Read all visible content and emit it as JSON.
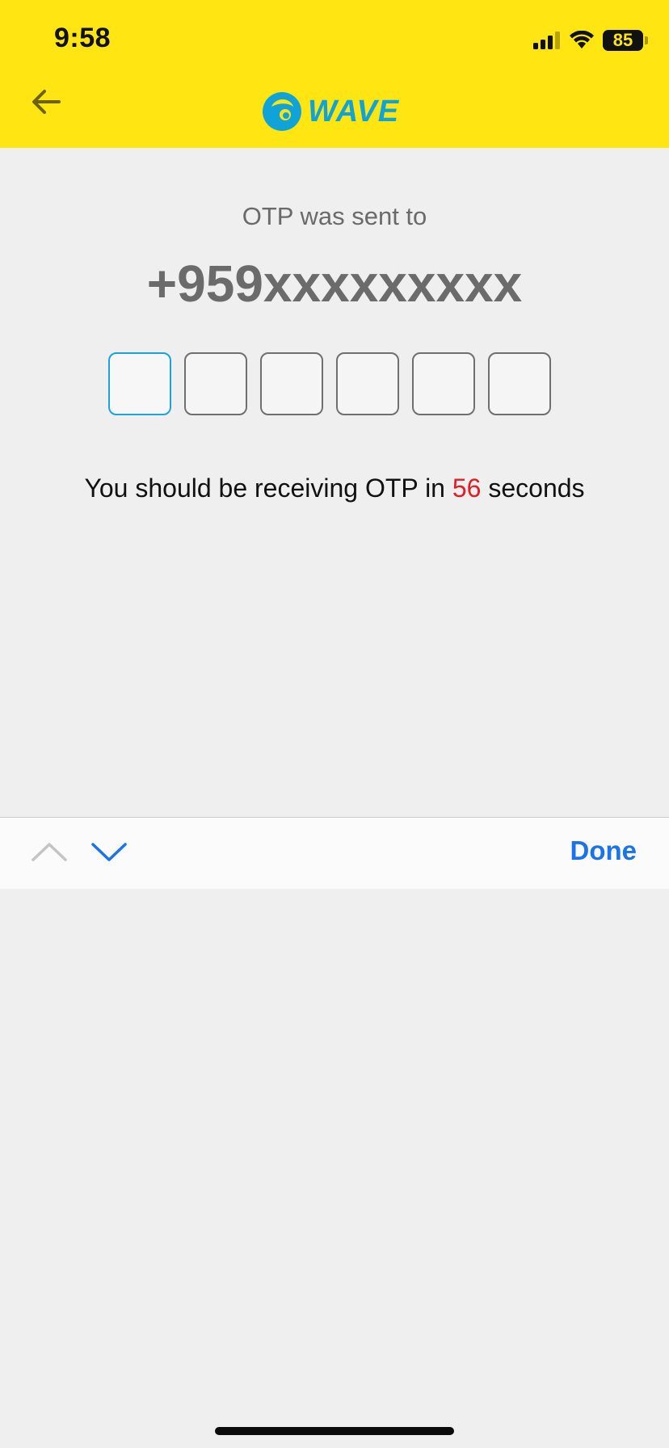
{
  "status_bar": {
    "time": "9:58",
    "battery": "85",
    "icons": [
      "signal-icon",
      "wifi-icon",
      "battery-icon"
    ]
  },
  "header": {
    "back_icon": "arrow-left-icon",
    "logo_text": "WAVE",
    "background": "#ffe512",
    "accent": "#10a3d8"
  },
  "otp": {
    "sent_to_label": "OTP was sent to",
    "phone": "+959xxxxxxxxx",
    "boxes": [
      "",
      "",
      "",
      "",
      "",
      ""
    ],
    "receive_prefix": "You should be receiving OTP in ",
    "seconds": "56",
    "receive_suffix": " seconds",
    "seconds_color": "#e21d24"
  },
  "keyboard_toolbar": {
    "up_icon": "chevron-up-icon",
    "down_icon": "chevron-down-icon",
    "done_label": "Done"
  }
}
